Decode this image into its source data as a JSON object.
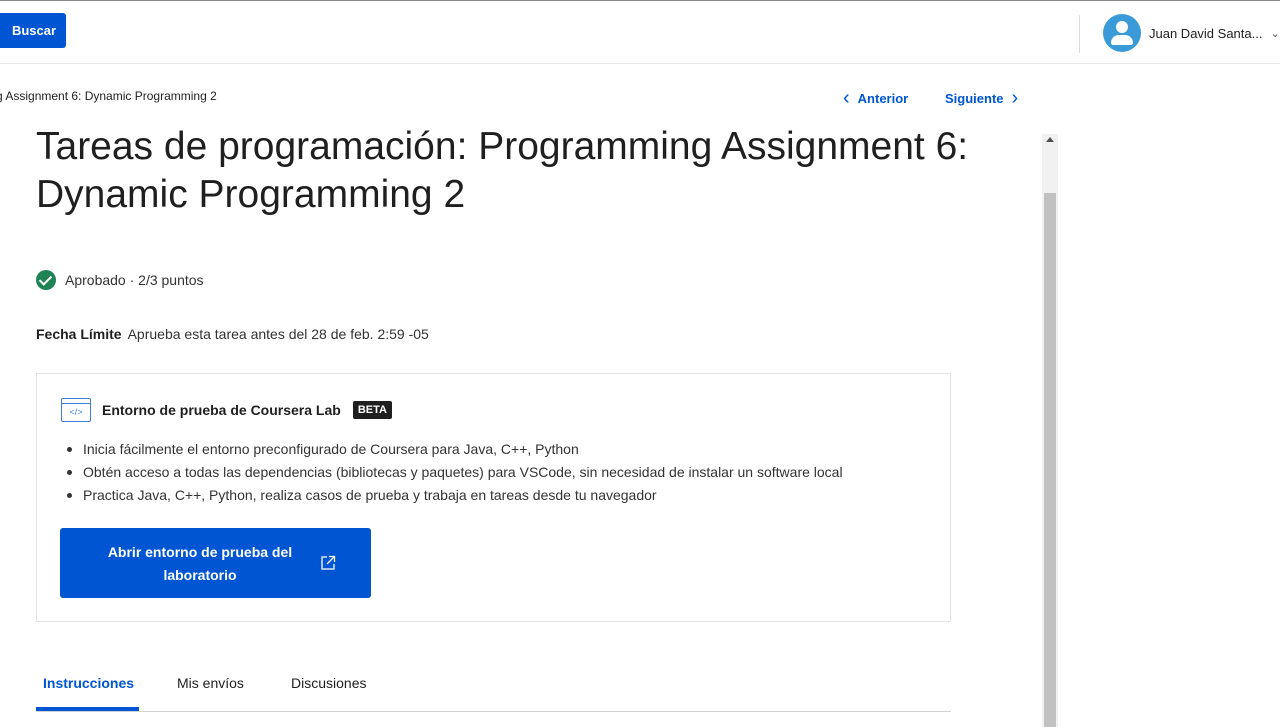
{
  "header": {
    "search_label": "Buscar",
    "user_name": "Juan David Santa...",
    "user_menu_icon": "chevron-down-icon"
  },
  "breadcrumb": {
    "text": "g Assignment 6: Dynamic Programming 2"
  },
  "navigation": {
    "prev_label": "Anterior",
    "next_label": "Siguiente"
  },
  "page": {
    "title": "Tareas de programación: Programming Assignment 6: Dynamic Programming 2",
    "status_text": "Aprobado · 2/3 puntos",
    "deadline_label": "Fecha Límite",
    "deadline_text": "Aprueba esta tarea antes del 28 de feb. 2:59 -05"
  },
  "lab": {
    "title": "Entorno de prueba de Coursera Lab",
    "badge": "BETA",
    "bullets": [
      "Inicia fácilmente el entorno preconfigurado de Coursera para Java, C++, Python",
      "Obtén acceso a todas las dependencias (bibliotecas y paquetes) para VSCode, sin necesidad de instalar un software local",
      "Practica Java, C++, Python, realiza casos de prueba y trabaja en tareas desde tu navegador"
    ],
    "button_label": "Abrir entorno de prueba del laboratorio"
  },
  "tabs": [
    {
      "label": "Instrucciones",
      "active": true
    },
    {
      "label": "Mis envíos",
      "active": false
    },
    {
      "label": "Discusiones",
      "active": false
    }
  ],
  "colors": {
    "accent": "#0056d2",
    "success": "#1f8354",
    "avatar": "#3a9bd8"
  }
}
